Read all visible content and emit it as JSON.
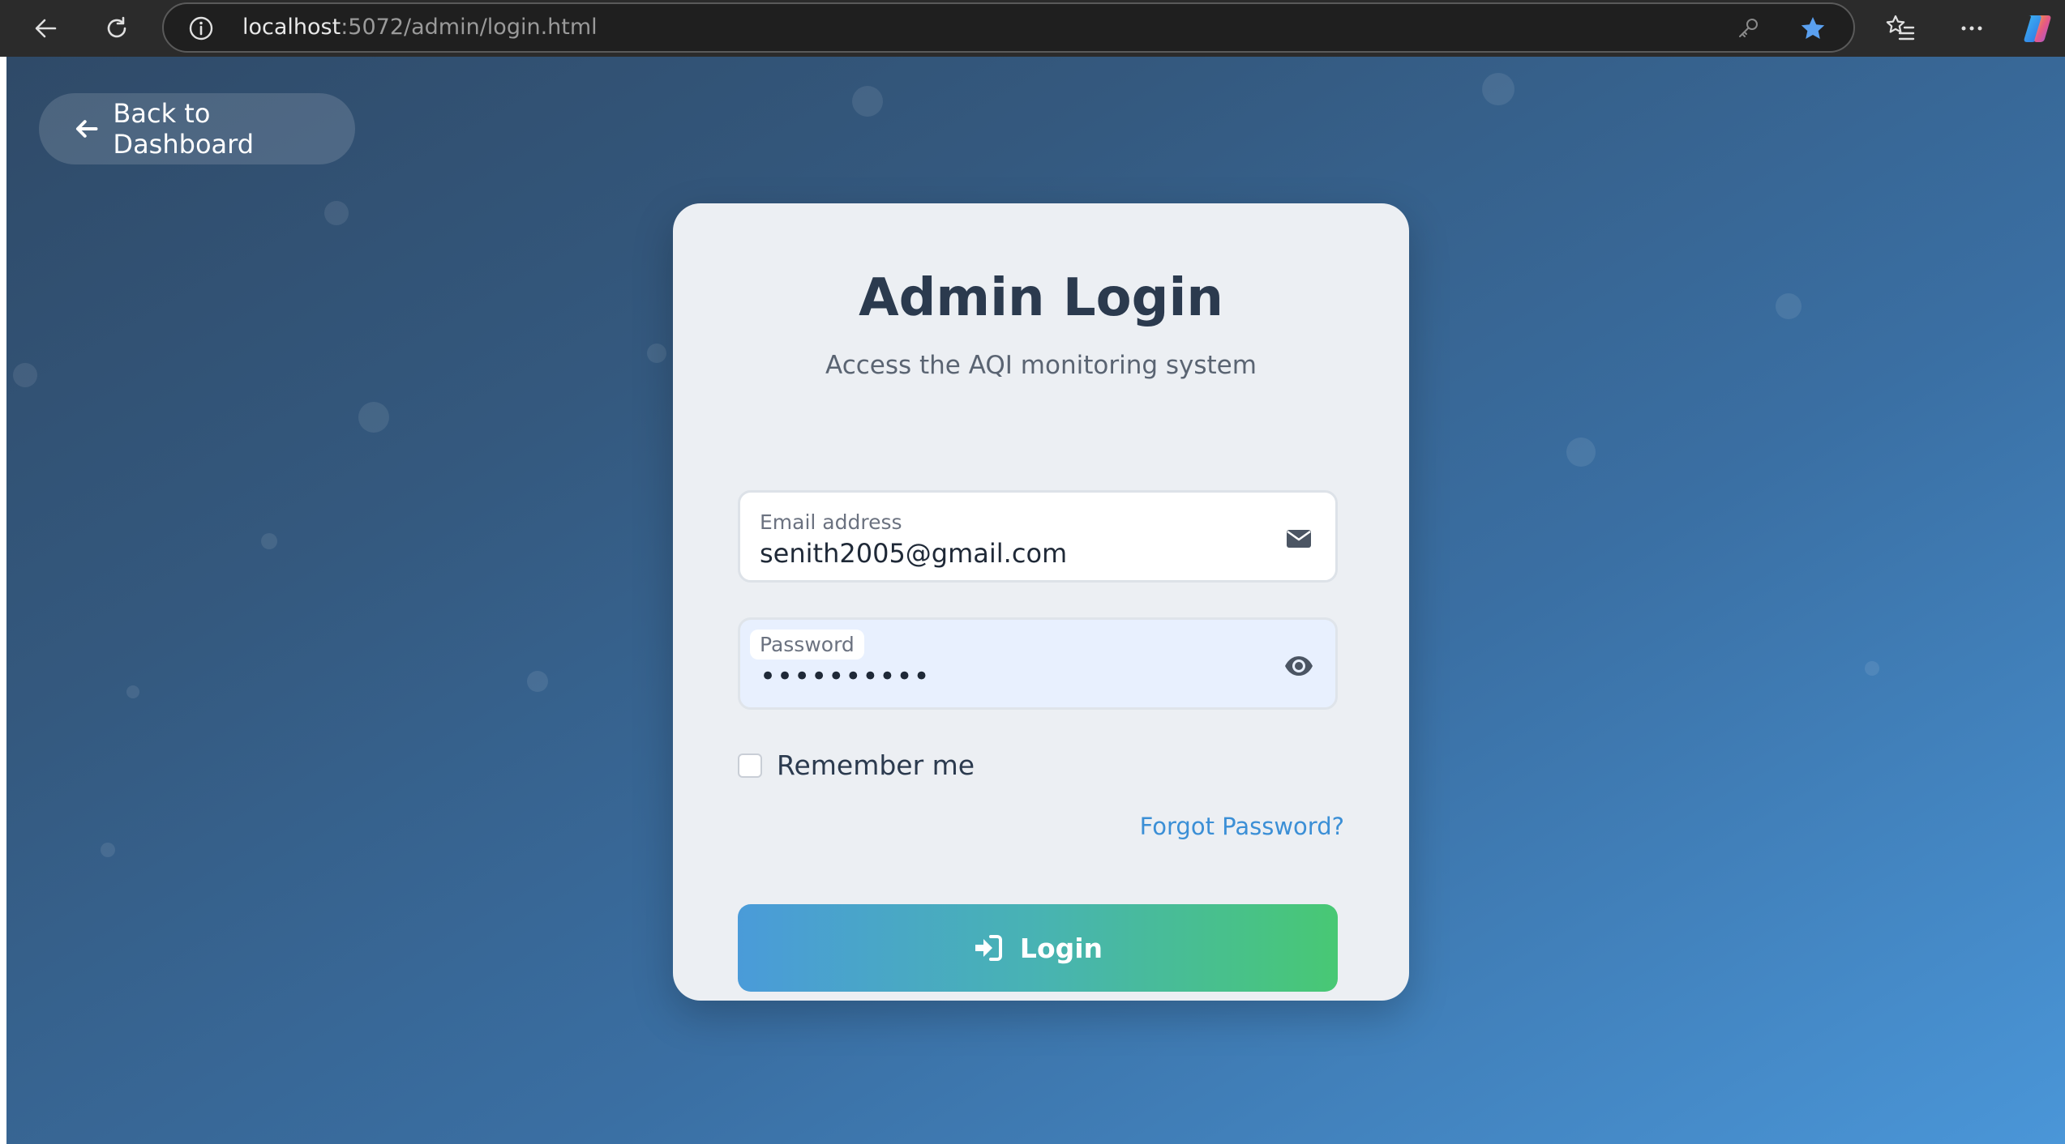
{
  "browser": {
    "url_host": "localhost",
    "url_path": ":5072/admin/login.html",
    "back_icon": "back-arrow-icon",
    "reload_icon": "reload-icon",
    "info_icon": "info-icon",
    "key_icon": "key-icon",
    "favorite_icon": "star-icon",
    "favorites_list_icon": "favorites-list-icon",
    "more_icon": "more-icon",
    "copilot_icon": "copilot-icon"
  },
  "page": {
    "back_button_label": "Back to Dashboard",
    "back_icon": "left-arrow-icon"
  },
  "login": {
    "title": "Admin Login",
    "subtitle": "Access the AQI monitoring system",
    "email": {
      "label": "Email address",
      "value": "senith2005@gmail.com",
      "icon": "envelope-icon"
    },
    "password": {
      "label": "Password",
      "value": "••••••••••",
      "icon": "eye-icon"
    },
    "remember_label": "Remember me",
    "remember_checked": false,
    "forgot_label": "Forgot Password?",
    "submit_label": "Login",
    "submit_icon": "sign-in-icon"
  },
  "colors": {
    "accent_link": "#3b8fd6",
    "button_gradient_start": "#4a9bd9",
    "button_gradient_end": "#48c874",
    "title_text": "#2b3a4e"
  }
}
